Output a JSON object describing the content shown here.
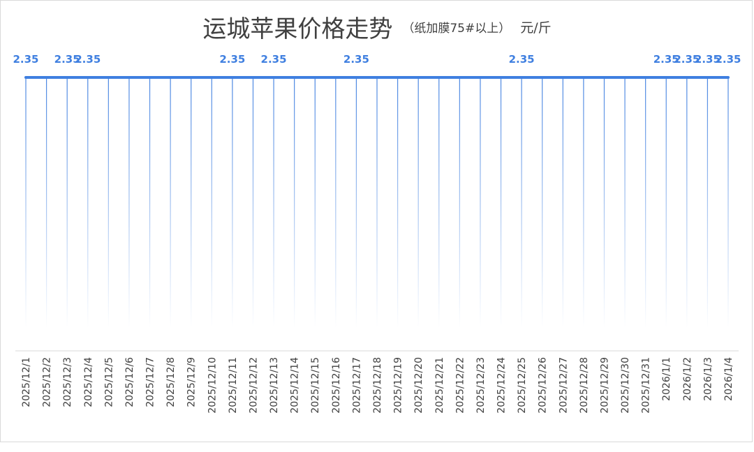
{
  "chart_data": {
    "type": "line",
    "title": "运城苹果价格走势",
    "subtitle": "（纸加膜75#以上）",
    "unit": "元/斤",
    "xlabel": "",
    "ylabel": "",
    "grid": false,
    "legend": "none",
    "x": [
      "2025/12/1",
      "2025/12/2",
      "2025/12/3",
      "2025/12/4",
      "2025/12/5",
      "2025/12/6",
      "2025/12/7",
      "2025/12/8",
      "2025/12/9",
      "2025/12/10",
      "2025/12/11",
      "2025/12/12",
      "2025/12/13",
      "2025/12/14",
      "2025/12/15",
      "2025/12/16",
      "2025/12/17",
      "2025/12/18",
      "2025/12/19",
      "2025/12/20",
      "2025/12/21",
      "2025/12/22",
      "2025/12/23",
      "2025/12/24",
      "2025/12/25",
      "2025/12/26",
      "2025/12/27",
      "2025/12/28",
      "2025/12/29",
      "2025/12/30",
      "2025/12/31",
      "2026/1/1",
      "2026/1/2",
      "2026/1/3",
      "2026/1/4"
    ],
    "series": [
      {
        "values": [
          2.35,
          2.35,
          2.35,
          2.35,
          2.35,
          2.35,
          2.35,
          2.35,
          2.35,
          2.35,
          2.35,
          2.35,
          2.35,
          2.35,
          2.35,
          2.35,
          2.35,
          2.35,
          2.35,
          2.35,
          2.35,
          2.35,
          2.35,
          2.35,
          2.35,
          2.35,
          2.35,
          2.35,
          2.35,
          2.35,
          2.35,
          2.35,
          2.35,
          2.35,
          2.35
        ],
        "color": "#3f7fe0"
      }
    ],
    "labeled_points": [
      "2025/12/1",
      "2025/12/3",
      "2025/12/4",
      "2025/12/11",
      "2025/12/13",
      "2025/12/17",
      "2025/12/25",
      "2026/1/1",
      "2026/1/2",
      "2026/1/3",
      "2026/1/4"
    ],
    "accent_color": "#3f7fe0",
    "axis_color": "#d9d9d9",
    "text_color": "#404040"
  }
}
